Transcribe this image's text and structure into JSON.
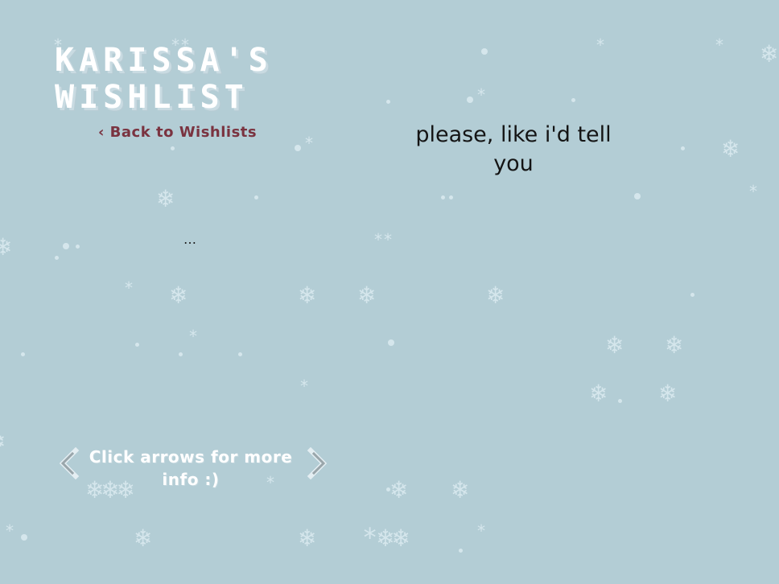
{
  "page": {
    "title_line1": "KARISSA'S",
    "title_line2": "WISHLIST",
    "back_link": "‹ Back to Wishlists",
    "ellipsis": "…",
    "item_text": "please, like i'd tell you",
    "hint": "Click arrows for more info :)"
  },
  "icons": {
    "prev": "chevron-left-icon",
    "next": "chevron-right-icon",
    "snow": "snowflake-icon"
  },
  "colors": {
    "background": "#b3cdd5",
    "title": "#ffffff",
    "back_link": "#7a3340",
    "text": "#141414",
    "snow": "#d5e6ec"
  }
}
